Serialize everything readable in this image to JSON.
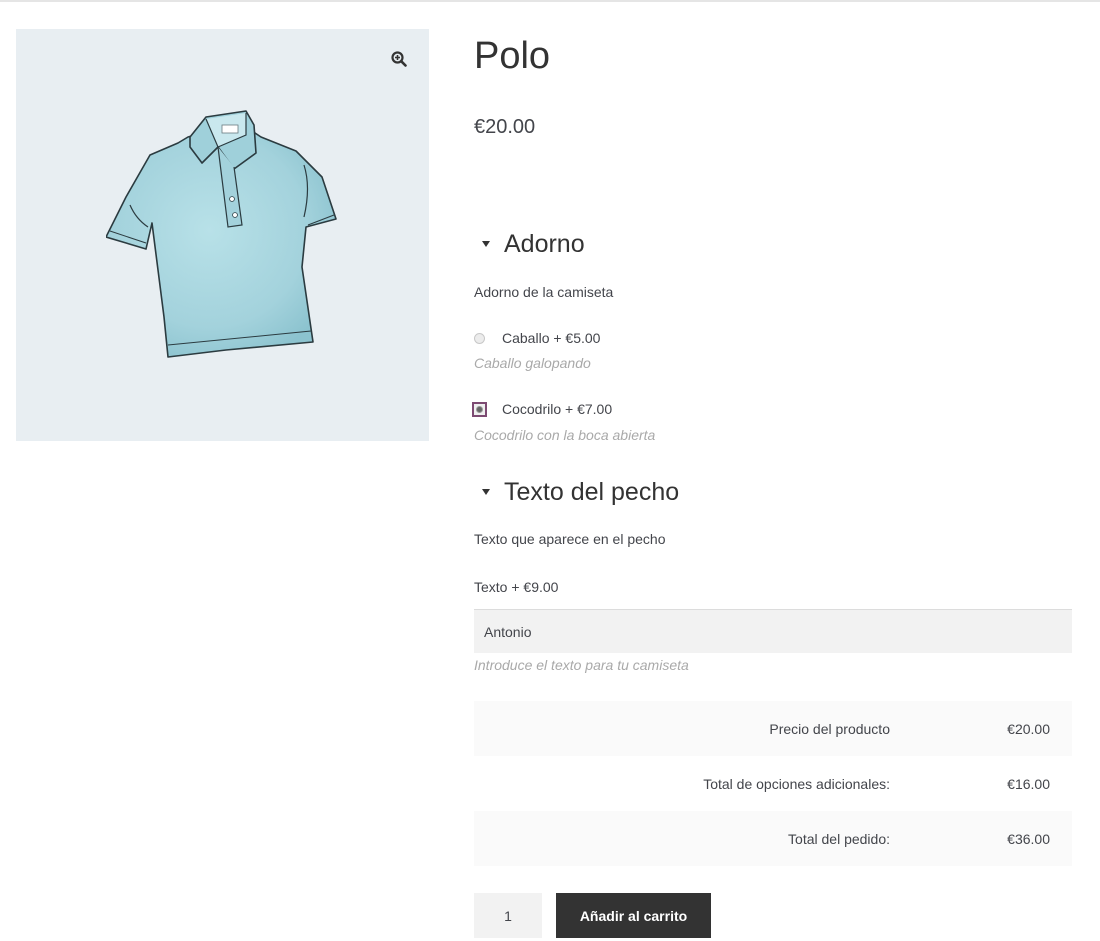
{
  "product": {
    "title": "Polo",
    "price": "€20.00"
  },
  "gallery": {
    "zoom_icon": "magnifier-plus-icon",
    "image": "polo-shirt-illustration"
  },
  "sections": [
    {
      "heading": "Adorno",
      "description": "Adorno de la camiseta",
      "options": [
        {
          "label": "Caballo + €5.00",
          "hint": "Caballo galopando",
          "checked": false
        },
        {
          "label": "Cocodrilo + €7.00",
          "hint": "Cocodrilo con la boca abierta",
          "checked": true
        }
      ]
    },
    {
      "heading": "Texto del pecho",
      "description": "Texto que aparece en el pecho",
      "field_label": "Texto + €9.00",
      "field_value": "Antonio",
      "hint": "Introduce el texto para tu camiseta"
    }
  ],
  "totals": [
    {
      "label": "Precio del producto",
      "value": "€20.00"
    },
    {
      "label": "Total de opciones adicionales:",
      "value": "€16.00"
    },
    {
      "label": "Total del pedido:",
      "value": "€36.00"
    }
  ],
  "cart": {
    "quantity": "1",
    "button_label": "Añadir al carrito"
  },
  "colors": {
    "accent": "#7d4a72",
    "button_bg": "#333333",
    "gallery_bg": "#e8eef2",
    "shirt": "#a9d7e0"
  }
}
